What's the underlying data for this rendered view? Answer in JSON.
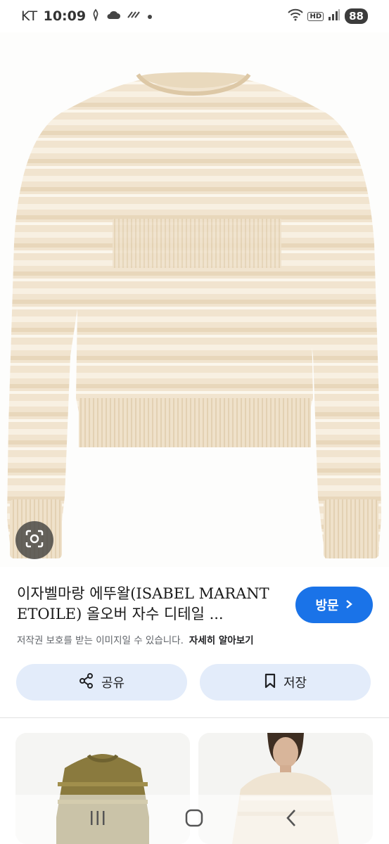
{
  "status_bar": {
    "carrier": "KT",
    "time": "10:09",
    "battery": "88",
    "hd_label": "HD"
  },
  "result": {
    "title": "이자벨마랑 에뚜왈(ISABEL MARANT ETOILE) 올오버 자수 디테일 ...",
    "visit_label": "방문",
    "copyright_notice": "저작권 보호를 받는 이미지일 수 있습니다.",
    "learn_more": "자세히 알아보기"
  },
  "actions": {
    "share_label": "공유",
    "save_label": "저장"
  },
  "colors": {
    "accent": "#1a73e8",
    "action_bg": "#e3ecfa",
    "sweater": "#f1e4cf",
    "olive_sweater": "#8a7a3e"
  },
  "icons": [
    "lens-icon",
    "share-icon",
    "bookmark-icon",
    "chevron-right-icon",
    "recents-icon",
    "home-icon",
    "back-icon"
  ]
}
